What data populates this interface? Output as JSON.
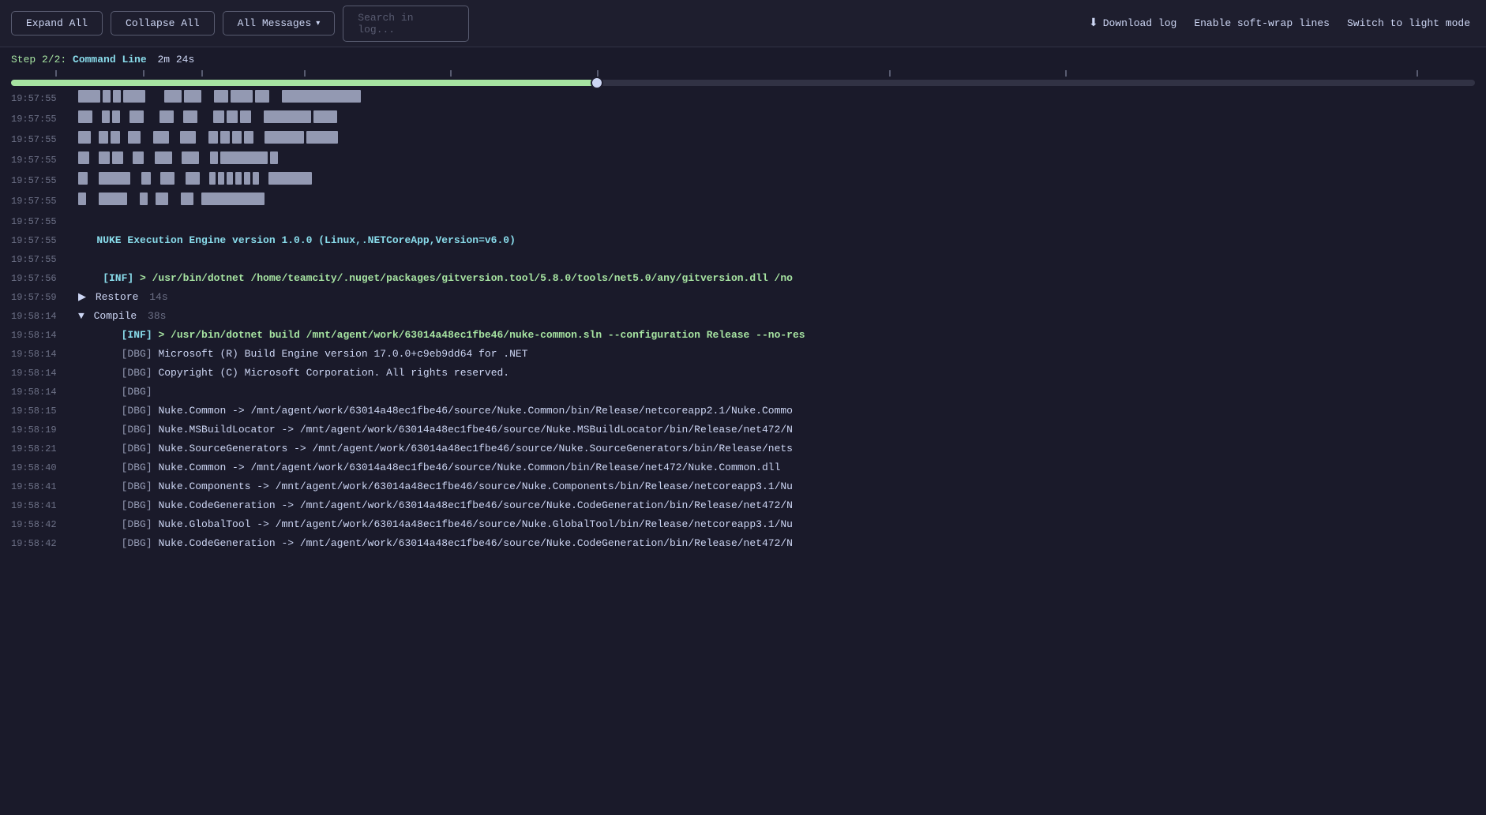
{
  "toolbar": {
    "expand_all": "Expand All",
    "collapse_all": "Collapse All",
    "all_messages": "All Messages",
    "search_placeholder": "Search in log...",
    "download_log": "Download log",
    "enable_soft_wrap": "Enable soft-wrap lines",
    "switch_mode": "Switch to light mode"
  },
  "progress": {
    "step": "Step 2/2:",
    "step_name": "Command Line",
    "duration": "2m 24s",
    "percent": 40
  },
  "log_lines": [
    {
      "ts": "19:57:55",
      "type": "ascii",
      "content": ""
    },
    {
      "ts": "19:57:55",
      "type": "ascii2",
      "content": ""
    },
    {
      "ts": "19:57:55",
      "type": "ascii3",
      "content": ""
    },
    {
      "ts": "19:57:55",
      "type": "ascii4",
      "content": ""
    },
    {
      "ts": "19:57:55",
      "type": "ascii5",
      "content": ""
    },
    {
      "ts": "19:57:55",
      "type": "ascii6",
      "content": ""
    },
    {
      "ts": "19:57:55",
      "type": "empty",
      "content": ""
    },
    {
      "ts": "19:57:55",
      "type": "nuke-engine",
      "content": "NUKE Execution Engine version 1.0.0 (Linux,.NETCoreApp,Version=v6.0)"
    },
    {
      "ts": "19:57:55",
      "type": "empty",
      "content": ""
    },
    {
      "ts": "19:57:56",
      "type": "inf-cmd",
      "content": "[INF] > /usr/bin/dotnet /home/teamcity/.nuget/packages/gitversion.tool/5.8.0/tools/net5.0/any/gitversion.dll /no"
    },
    {
      "ts": "19:57:59",
      "type": "section-collapsed",
      "label": "Restore",
      "time": "14s"
    },
    {
      "ts": "19:58:14",
      "type": "section-expanded",
      "label": "Compile",
      "time": "38s"
    },
    {
      "ts": "19:58:14",
      "type": "inf-cmd",
      "content": "[INF] > /usr/bin/dotnet build /mnt/agent/work/63014a48ec1fbe46/nuke-common.sln --configuration Release --no-res"
    },
    {
      "ts": "19:58:14",
      "type": "dbg",
      "content": "[DBG] Microsoft (R) Build Engine version 17.0.0+c9eb9dd64 for .NET"
    },
    {
      "ts": "19:58:14",
      "type": "dbg",
      "content": "[DBG] Copyright (C) Microsoft Corporation. All rights reserved."
    },
    {
      "ts": "19:58:14",
      "type": "dbg-empty",
      "content": "[DBG]"
    },
    {
      "ts": "19:58:15",
      "type": "dbg-path",
      "content": "[DBG]    Nuke.Common -> /mnt/agent/work/63014a48ec1fbe46/source/Nuke.Common/bin/Release/netcoreapp2.1/Nuke.Commo"
    },
    {
      "ts": "19:58:19",
      "type": "dbg-path",
      "content": "[DBG]    Nuke.MSBuildLocator -> /mnt/agent/work/63014a48ec1fbe46/source/Nuke.MSBuildLocator/bin/Release/net472/N"
    },
    {
      "ts": "19:58:21",
      "type": "dbg-path",
      "content": "[DBG]    Nuke.SourceGenerators -> /mnt/agent/work/63014a48ec1fbe46/source/Nuke.SourceGenerators/bin/Release/nets"
    },
    {
      "ts": "19:58:40",
      "type": "dbg-path",
      "content": "[DBG]    Nuke.Common -> /mnt/agent/work/63014a48ec1fbe46/source/Nuke.Common/bin/Release/net472/Nuke.Common.dll"
    },
    {
      "ts": "19:58:41",
      "type": "dbg-path",
      "content": "[DBG]    Nuke.Components -> /mnt/agent/work/63014a48ec1fbe46/source/Nuke.Components/bin/Release/netcoreapp3.1/Nu"
    },
    {
      "ts": "19:58:41",
      "type": "dbg-path",
      "content": "[DBG]    Nuke.CodeGeneration -> /mnt/agent/work/63014a48ec1fbe46/source/Nuke.CodeGeneration/bin/Release/net472/N"
    },
    {
      "ts": "19:58:42",
      "type": "dbg-path",
      "content": "[DBG]    Nuke.GlobalTool -> /mnt/agent/work/63014a48ec1fbe46/source/Nuke.GlobalTool/bin/Release/netcoreapp3.1/Nu"
    },
    {
      "ts": "19:58:42",
      "type": "dbg-path",
      "content": "[DBG]    Nuke.CodeGeneration -> /mnt/agent/work/63014a48ec1fbe46/source/Nuke.CodeGeneration/bin/Release/net472/N"
    }
  ]
}
